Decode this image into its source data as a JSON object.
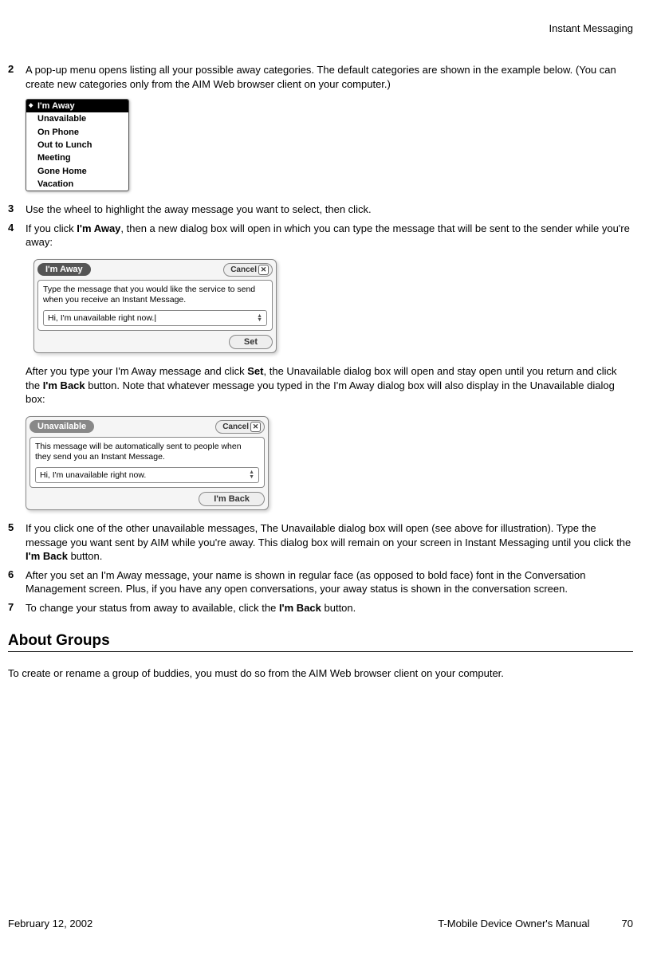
{
  "header": {
    "section": "Instant Messaging"
  },
  "steps": {
    "s2": {
      "num": "2",
      "text": "A pop-up menu opens listing all your possible away categories. The default categories are shown in the example below. (You can create new categories only from the AIM Web browser client on your computer.)"
    },
    "s3": {
      "num": "3",
      "text": "Use the wheel to highlight the away message you want to select, then click."
    },
    "s4": {
      "num": "4",
      "pre": "If you click ",
      "bold1": "I'm Away",
      "post1": ", then a new dialog box will open in which you can type the message that will be sent to the sender while you're away:"
    },
    "s4_after": {
      "pre": "After you type your I'm Away message and click ",
      "b1": "Set",
      "mid1": ", the Unavailable dialog box will open and stay open until you return and click the ",
      "b2": "I'm Back",
      "post": " button. Note that whatever message you typed in the I'm Away dialog box will also display in the Unavailable dialog box:"
    },
    "s5": {
      "num": "5",
      "pre": "If you click one of the other unavailable messages, The Unavailable dialog box will open (see above for illustration). Type the message you want sent by AIM while you're away. This dialog box will remain on your screen in Instant Messaging until you click the ",
      "b1": "I'm Back",
      "post": " button."
    },
    "s6": {
      "num": "6",
      "text": "After you set an I'm Away message, your name is shown in regular face (as opposed to bold face) font in the Conversation Management screen. Plus, if you have any open conversations, your away status is shown in the conversation screen."
    },
    "s7": {
      "num": "7",
      "pre": "To change your status from away to available, click the ",
      "b1": "I'm Back",
      "post": " button."
    }
  },
  "popup": {
    "items": [
      "I'm Away",
      "Unavailable",
      "On Phone",
      "Out to Lunch",
      "Meeting",
      "Gone Home",
      "Vacation"
    ]
  },
  "dialog1": {
    "title": "I'm Away",
    "cancel": "Cancel",
    "desc": "Type the message that you would like the service to send when you receive an Instant Message.",
    "input": "Hi, I'm unavailable right now.|",
    "action": "Set"
  },
  "dialog2": {
    "title": "Unavailable",
    "cancel": "Cancel",
    "desc": "This message will be automatically sent to people when they send you an Instant Message.",
    "input": "Hi, I'm unavailable right now.",
    "action": "I'm Back"
  },
  "section": {
    "heading": "About Groups",
    "para": "To create or rename a group of buddies, you must do so from the AIM Web browser client on your computer."
  },
  "footer": {
    "date": "February 12, 2002",
    "title": "T-Mobile Device Owner's Manual",
    "page": "70"
  }
}
